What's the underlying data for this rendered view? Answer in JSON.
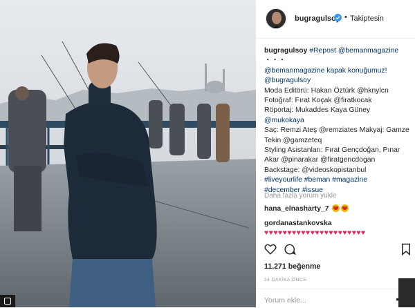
{
  "post": {
    "username": "bugragulsoy",
    "follow_status": "Takiptesin",
    "caption_lines": [
      {
        "user": "bugragulsoy",
        "text": " #Repost @bemanmagazine"
      },
      {
        "text": "・・・"
      },
      {
        "text": "@bemanmagazine kapak konuğumuz!"
      },
      {
        "text": "@bugragulsoy"
      },
      {
        "text": "Moda Editörü: Hakan Öztürk @hknylcn"
      },
      {
        "text": "Fotoğraf: Fırat Koçak @firatkocak"
      },
      {
        "text": "Röportaj: Mukaddes Kaya Güney"
      },
      {
        "text": "@mukokaya"
      },
      {
        "text": "Saç: Remzi Ateş @remziates Makyaj: Gamze"
      },
      {
        "text": "Tekin @gamzeteq"
      },
      {
        "text": "Styling Asistanları: Fırat Gençdoğan, Pınar"
      },
      {
        "text": "Akar @pinarakar @firatgencdogan"
      },
      {
        "text": "Backstage: @videoskopistanbul"
      },
      {
        "text": "#liveyourlife #beman #magazine"
      },
      {
        "text": "#december #issue"
      }
    ],
    "load_more": "Daha fazla yorum yükle",
    "comments": [
      {
        "user": "hana_elnasharty_7",
        "text": ""
      },
      {
        "user": "gordanastankovska",
        "text": "♥♥♥♥♥♥♥♥♥♥♥♥♥♥♥♥♥♥♥♥♥♥"
      }
    ],
    "likes": "11.271 beğenme",
    "time_ago": "34 DAKİKA ÖNCE",
    "comment_placeholder": "Yorum ekle...",
    "more_options": "•••"
  },
  "icons": {
    "verified": "verified-badge-icon",
    "like": "heart-outline-icon",
    "comment": "comment-bubble-icon",
    "save": "bookmark-icon"
  },
  "colors": {
    "verified": "#3897f0",
    "link": "#003569",
    "heart": "#e0245e"
  }
}
